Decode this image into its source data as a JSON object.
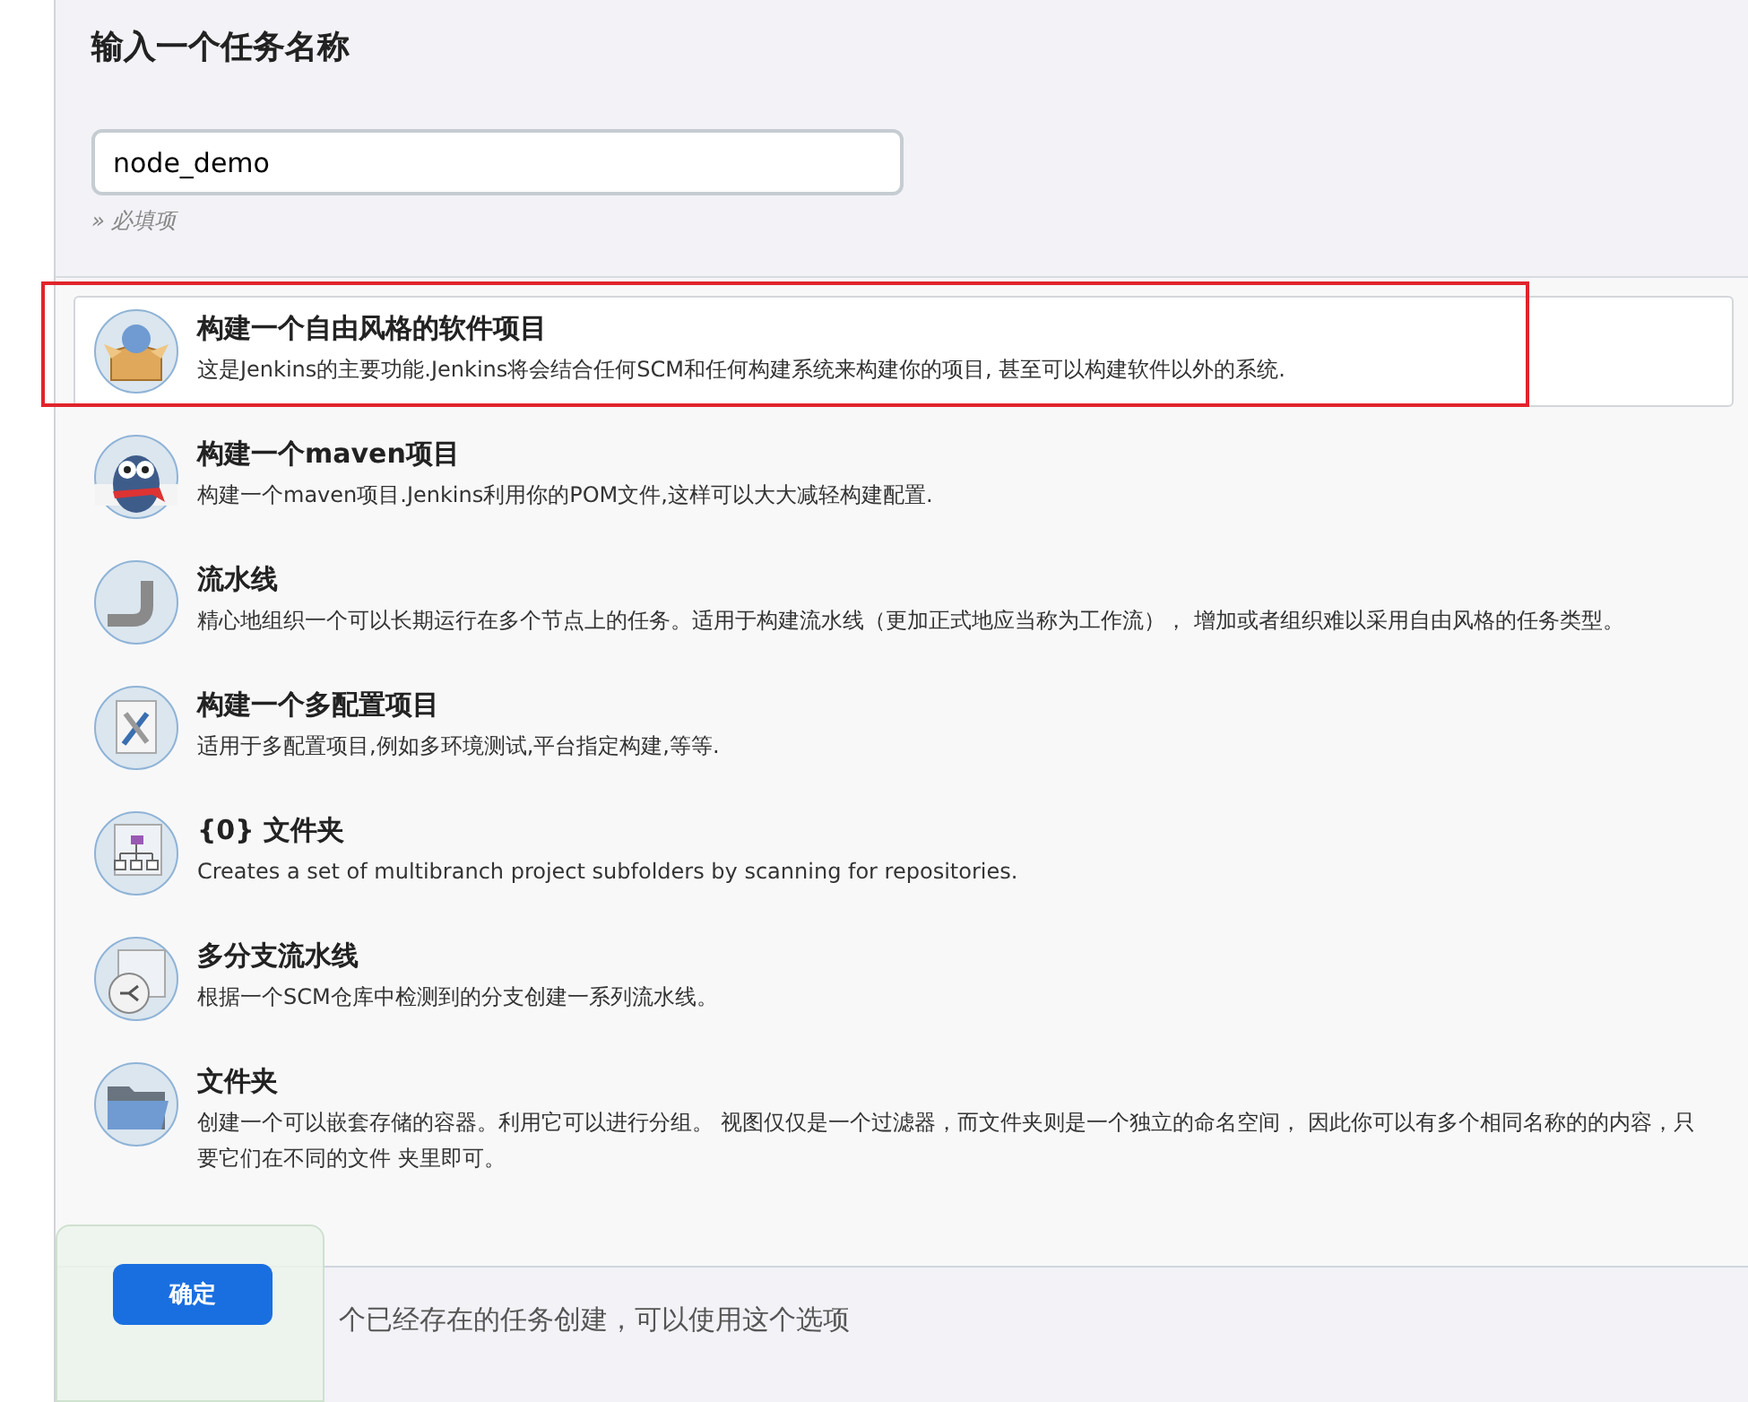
{
  "heading": "输入一个任务名称",
  "name_field": {
    "value": "node_demo",
    "hint": "» 必填项"
  },
  "items": [
    {
      "title": "构建一个自由风格的软件项目",
      "description": "这是Jenkins的主要功能.Jenkins将会结合任何SCM和任何构建系统来构建你的项目, 甚至可以构建软件以外的系统.",
      "selected": true,
      "marked": true
    },
    {
      "title": "构建一个maven项目",
      "description": "构建一个maven项目.Jenkins利用你的POM文件,这样可以大大减轻构建配置.",
      "selected": false,
      "marked": false
    },
    {
      "title": "流水线",
      "description": "精心地组织一个可以长期运行在多个节点上的任务。适用于构建流水线（更加正式地应当称为工作流）， 增加或者组织难以采用自由风格的任务类型。",
      "selected": false,
      "marked": false
    },
    {
      "title": "构建一个多配置项目",
      "description": "适用于多配置项目,例如多环境测试,平台指定构建,等等.",
      "selected": false,
      "marked": false
    },
    {
      "title": "{0} 文件夹",
      "description": "Creates a set of multibranch project subfolders by scanning for repositories.",
      "selected": false,
      "marked": false
    },
    {
      "title": "多分支流水线",
      "description": "根据一个SCM仓库中检测到的分支创建一系列流水线。",
      "selected": false,
      "marked": false
    },
    {
      "title": "文件夹",
      "description": "创建一个可以嵌套存储的容器。利用它可以进行分组。 视图仅仅是一个过滤器，而文件夹则是一个独立的命名空间， 因此你可以有多个相同名称的的内容，只要它们在不同的文件 夹里即可。",
      "selected": false,
      "marked": false
    }
  ],
  "copy_hint": "个已经存在的任务创建，可以使用这个选项",
  "ok_button": "确定"
}
